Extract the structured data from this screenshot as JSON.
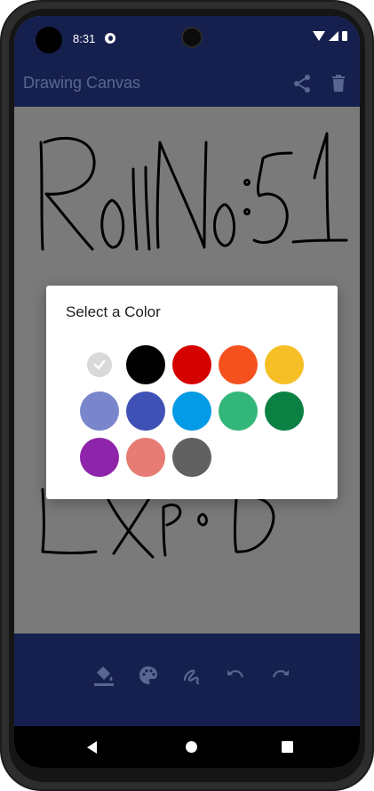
{
  "status_bar": {
    "time": "8:31"
  },
  "app_bar": {
    "title": "Drawing Canvas",
    "actions": [
      "share-icon",
      "delete-icon"
    ]
  },
  "toolbar": {
    "tools": [
      "fill-icon",
      "palette-icon",
      "brush-icon",
      "undo-icon",
      "redo-icon"
    ]
  },
  "dialog": {
    "title": "Select a Color",
    "selected_index": 0,
    "colors": [
      {
        "hex": "#d9d9d9"
      },
      {
        "hex": "#000000"
      },
      {
        "hex": "#d50000"
      },
      {
        "hex": "#f4511e"
      },
      {
        "hex": "#f6bf26"
      },
      {
        "hex": "#7986cb"
      },
      {
        "hex": "#3f51b5"
      },
      {
        "hex": "#039be5"
      },
      {
        "hex": "#33b679"
      },
      {
        "hex": "#0b8043"
      },
      {
        "hex": "#8e24aa"
      },
      {
        "hex": "#e67c73"
      },
      {
        "hex": "#616161"
      }
    ]
  },
  "navigation": {
    "buttons": [
      "back-icon",
      "home-icon",
      "recents-icon"
    ]
  }
}
